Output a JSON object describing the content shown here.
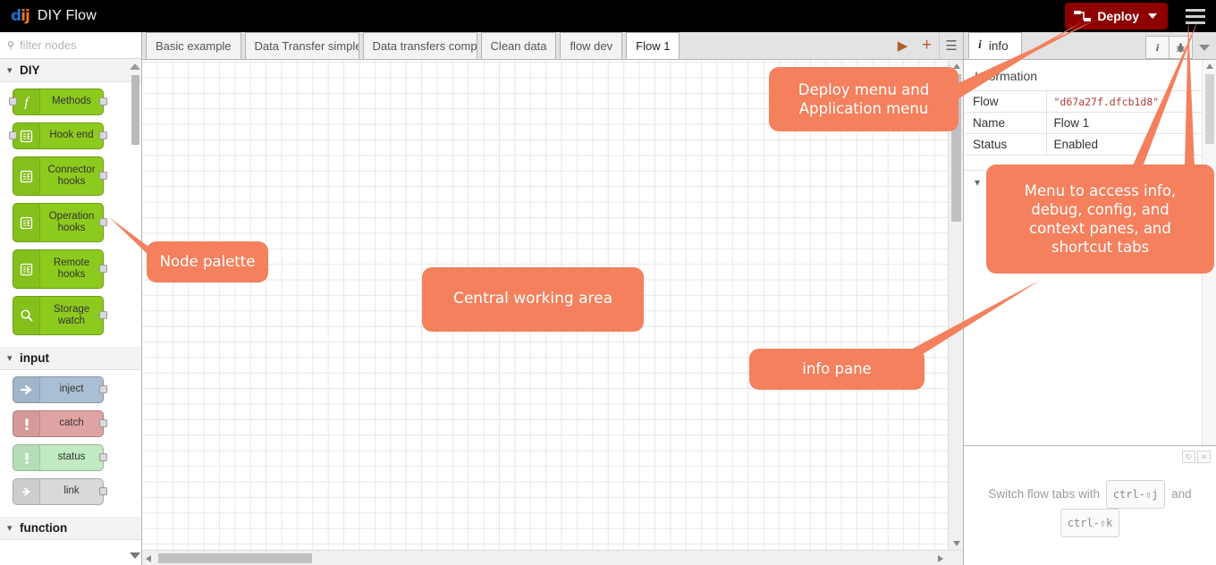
{
  "header": {
    "logo_left": "d",
    "logo_right": "ij",
    "logo_icon": "diy-flow-logo",
    "title": "DIY Flow",
    "deploy_label": "Deploy",
    "deploy_icon": "deploy-nodes-icon",
    "deploy_caret_icon": "chevron-down-icon",
    "menu_icon": "hamburger-menu-icon",
    "deploy_color": "#8e0000"
  },
  "palette": {
    "search_placeholder": "filter nodes",
    "search_value": "",
    "search_icon": "search-icon",
    "categories": [
      {
        "label": "DIY",
        "expanded": true,
        "nodes": [
          {
            "label": "Methods",
            "color": "c-green",
            "icon": "function-icon",
            "has_input": true,
            "has_output": true,
            "tall": false
          },
          {
            "label": "Hook end",
            "color": "c-green",
            "icon": "hook-icon",
            "has_input": true,
            "has_output": true,
            "tall": false
          },
          {
            "label": "Connector hooks",
            "color": "c-green",
            "icon": "hook-icon",
            "has_input": false,
            "has_output": true,
            "tall": true
          },
          {
            "label": "Operation hooks",
            "color": "c-green",
            "icon": "hook-icon",
            "has_input": false,
            "has_output": true,
            "tall": true
          },
          {
            "label": "Remote hooks",
            "color": "c-green",
            "icon": "hook-icon",
            "has_input": false,
            "has_output": true,
            "tall": true
          },
          {
            "label": "Storage watch",
            "color": "c-green",
            "icon": "magnifier-icon",
            "has_input": false,
            "has_output": true,
            "tall": true
          }
        ]
      },
      {
        "label": "input",
        "expanded": true,
        "nodes": [
          {
            "label": "inject",
            "color": "c-blue",
            "icon": "inject-arrow-icon",
            "has_input": false,
            "has_output": true,
            "tall": false
          },
          {
            "label": "catch",
            "color": "c-red",
            "icon": "exclamation-icon",
            "has_input": false,
            "has_output": true,
            "tall": false
          },
          {
            "label": "status",
            "color": "c-mint",
            "icon": "exclamation-icon",
            "has_input": false,
            "has_output": true,
            "tall": false
          },
          {
            "label": "link",
            "color": "c-grey",
            "icon": "link-arrow-icon",
            "has_input": false,
            "has_output": true,
            "tall": false
          }
        ]
      },
      {
        "label": "function",
        "expanded": true,
        "nodes": []
      }
    ]
  },
  "workspace": {
    "tabs": [
      {
        "label": "Basic example",
        "active": false
      },
      {
        "label": "Data Transfer simple",
        "active": false
      },
      {
        "label": "Data transfers complex",
        "active": false
      },
      {
        "label": "Clean data",
        "active": false
      },
      {
        "label": "flow dev",
        "active": false
      },
      {
        "label": "Flow 1",
        "active": true
      }
    ],
    "tools": [
      {
        "name": "run-flow-button",
        "icon": "play-icon",
        "glyph": "▶"
      },
      {
        "name": "add-flow-button",
        "icon": "plus-icon",
        "glyph": "+"
      },
      {
        "name": "list-flows-button",
        "icon": "list-menu-icon",
        "glyph": "☰"
      }
    ]
  },
  "info_pane": {
    "tab_label": "info",
    "tab_icon": "info-i-icon",
    "tools": [
      {
        "name": "info-tab-button",
        "icon": "info-i-icon",
        "glyph": "i"
      },
      {
        "name": "debug-tab-button",
        "icon": "bug-icon",
        "glyph": "✱"
      },
      {
        "name": "more-panes-button",
        "icon": "caret-down-icon",
        "glyph": "▼"
      }
    ],
    "section_title": "Information",
    "rows": [
      {
        "label": "Flow",
        "value": "\"d67a27f.dfcb1d8\"",
        "mono": true
      },
      {
        "label": "Name",
        "value": "Flow 1",
        "mono": false
      },
      {
        "label": "Status",
        "value": "Enabled",
        "mono": false
      }
    ],
    "second_section_label": ""
  },
  "footer": {
    "refresh_icon": "refresh-icon",
    "close_icon": "close-x-icon",
    "hint_prefix": "Switch flow tabs with",
    "hint_key_1": "ctrl-⇧j",
    "hint_middle": "and",
    "hint_key_2": "ctrl-⇧k"
  },
  "annotations": {
    "color": "#F4805E",
    "items": [
      {
        "name": "annotation-node-palette",
        "text": "Node palette"
      },
      {
        "name": "annotation-working-area",
        "text": "Central working area"
      },
      {
        "name": "annotation-deploy-menu",
        "text": "Deploy menu and\nApplication menu"
      },
      {
        "name": "annotation-sidebar-menu",
        "text": "Menu to access info,\ndebug, config, and\ncontext panes, and\nshortcut tabs"
      },
      {
        "name": "annotation-info-pane",
        "text": "info pane"
      }
    ]
  }
}
